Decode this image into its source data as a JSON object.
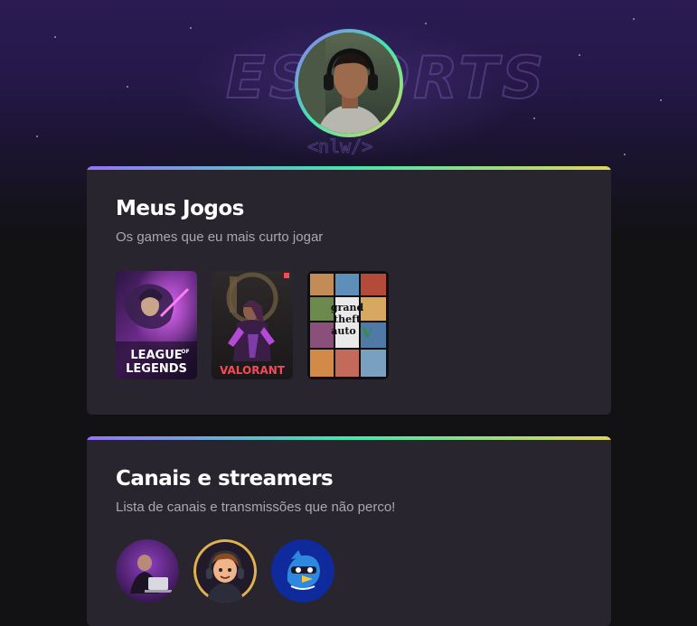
{
  "colors": {
    "background": "#121214",
    "card": "#29252f",
    "gradient_start": "#9572fc",
    "gradient_mid": "#43e7ad",
    "gradient_end": "#e2d45c",
    "heading": "#ffffff",
    "subtitle": "#a8a8b3"
  },
  "profile": {
    "avatar_icon": "profile-photo-headphones"
  },
  "games_card": {
    "title": "Meus Jogos",
    "subtitle": "Os games que eu mais curto jogar",
    "games": [
      {
        "name": "League of Legends",
        "cover_line1": "LEAGUE",
        "cover_line2": "LEGENDS",
        "cover_of": "OF"
      },
      {
        "name": "Valorant",
        "cover_text": "VALORANT"
      },
      {
        "name": "Grand Theft Auto V",
        "cover_line1": "grand",
        "cover_line2": "theft",
        "cover_line3": "auto",
        "cover_numeral": "V"
      }
    ]
  },
  "channels_card": {
    "title": "Canais e streamers",
    "subtitle": "Lista de canais e transmissões que não perco!",
    "channels": [
      {
        "icon": "streamer-at-laptop-avatar"
      },
      {
        "icon": "cartoon-gamer-avatar"
      },
      {
        "icon": "blue-bird-mascot-avatar"
      }
    ]
  }
}
